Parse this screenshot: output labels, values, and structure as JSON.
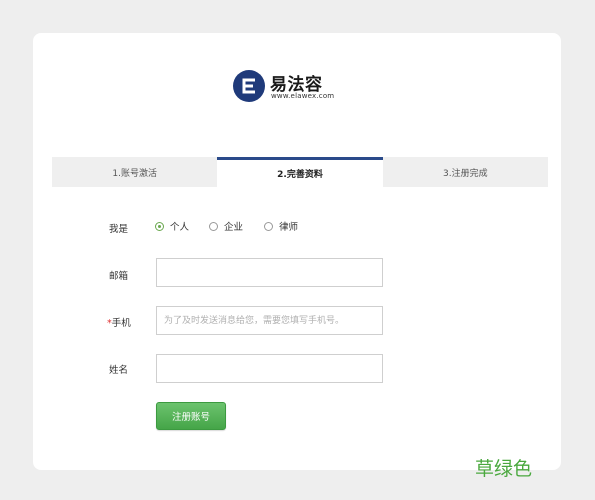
{
  "brand": {
    "name": "易法容",
    "url": "www.elawex.com",
    "color": "#1f3a7a"
  },
  "steps": [
    {
      "label": "1.账号激活",
      "active": false
    },
    {
      "label": "2.完善资料",
      "active": true
    },
    {
      "label": "3.注册完成",
      "active": false
    }
  ],
  "form": {
    "identity": {
      "label": "我是",
      "options": [
        "个人",
        "企业",
        "律师"
      ],
      "selected": "个人"
    },
    "email": {
      "label": "邮箱",
      "value": "",
      "placeholder": ""
    },
    "phone": {
      "required_mark": "*",
      "label": "手机",
      "value": "",
      "placeholder": "为了及时发送消息给您，需要您填写手机号。"
    },
    "name": {
      "label": "姓名",
      "value": "",
      "placeholder": ""
    },
    "submit_label": "注册账号"
  },
  "watermark": "草绿色",
  "colors": {
    "accent_green": "#4aa83e",
    "step_active": "#2a4a8a"
  }
}
